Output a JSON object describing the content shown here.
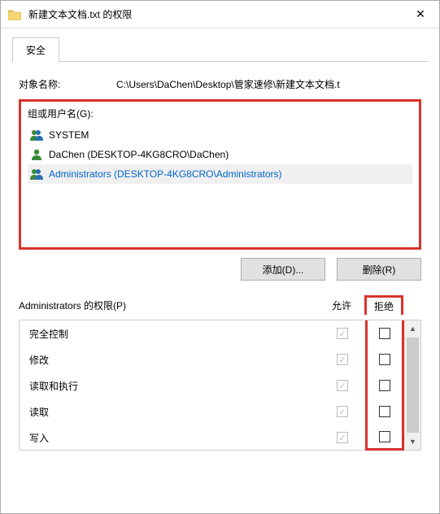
{
  "window": {
    "title": "新建文本文档.txt 的权限",
    "close_glyph": "✕"
  },
  "tab": {
    "security": "安全"
  },
  "object": {
    "label": "对象名称:",
    "value": "C:\\Users\\DaChen\\Desktop\\管家速修\\新建文本文档.t"
  },
  "group": {
    "label": "组或用户名(G):",
    "items": [
      {
        "name": "SYSTEM",
        "icon": "users",
        "selected": false
      },
      {
        "name": "DaChen (DESKTOP-4KG8CRO\\DaChen)",
        "icon": "user",
        "selected": false
      },
      {
        "name": "Administrators (DESKTOP-4KG8CRO\\Administrators)",
        "icon": "users",
        "selected": true
      }
    ]
  },
  "buttons": {
    "add": "添加(D)...",
    "remove": "删除(R)"
  },
  "perm": {
    "header_label": "Administrators 的权限(P)",
    "allow_label": "允许",
    "deny_label": "拒绝",
    "rows": [
      {
        "name": "完全控制",
        "allow": true,
        "deny": false
      },
      {
        "name": "修改",
        "allow": true,
        "deny": false
      },
      {
        "name": "读取和执行",
        "allow": true,
        "deny": false
      },
      {
        "name": "读取",
        "allow": true,
        "deny": false
      },
      {
        "name": "写入",
        "allow": true,
        "deny": false
      }
    ]
  }
}
